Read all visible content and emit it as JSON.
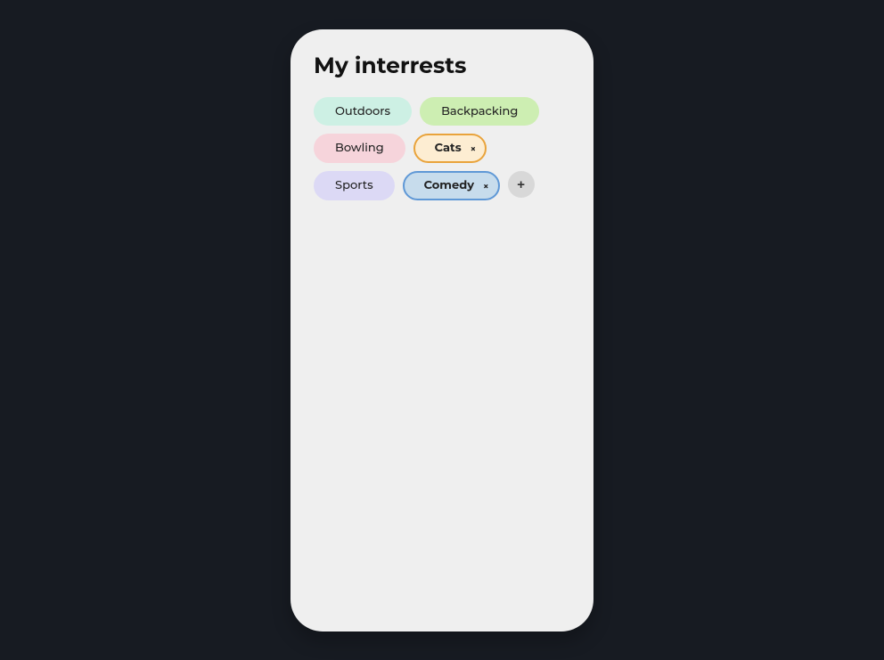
{
  "title": "My interrests",
  "tags": [
    {
      "label": "Outdoors",
      "colorClass": "tag-outdoors",
      "selected": false
    },
    {
      "label": "Backpacking",
      "colorClass": "tag-backpacking",
      "selected": false
    },
    {
      "label": "Bowling",
      "colorClass": "tag-bowling",
      "selected": false
    },
    {
      "label": "Cats",
      "colorClass": "tag-cats",
      "selected": true
    },
    {
      "label": "Sports",
      "colorClass": "tag-sports",
      "selected": false
    },
    {
      "label": "Comedy",
      "colorClass": "tag-comedy",
      "selected": true
    }
  ],
  "closeGlyph": "×",
  "addGlyph": "+",
  "colors": {
    "background": "#171b22",
    "card": "#efefef"
  }
}
